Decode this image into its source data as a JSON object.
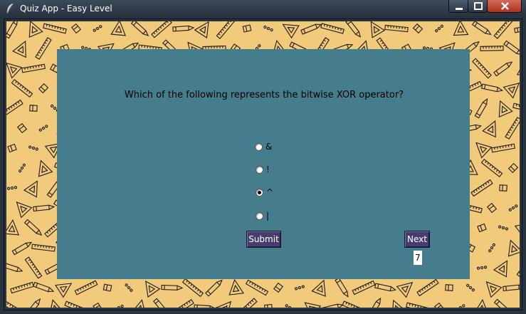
{
  "window": {
    "title": "Quiz App - Easy Level",
    "icon": "feather-icon",
    "controls": {
      "minimize": "minimize-icon",
      "maximize": "maximize-icon",
      "close": "close-icon"
    }
  },
  "quiz": {
    "question": "Which of the following represents the bitwise XOR operator?",
    "options": [
      {
        "label": "&",
        "selected": false
      },
      {
        "label": "!",
        "selected": false
      },
      {
        "label": "^",
        "selected": true
      },
      {
        "label": "|",
        "selected": false
      }
    ],
    "submit_label": "Submit",
    "next_label": "Next",
    "counter": "7"
  },
  "colors": {
    "background_pattern": "#f1ca7b",
    "panel": "#467d8c",
    "button": "#473d6d"
  }
}
